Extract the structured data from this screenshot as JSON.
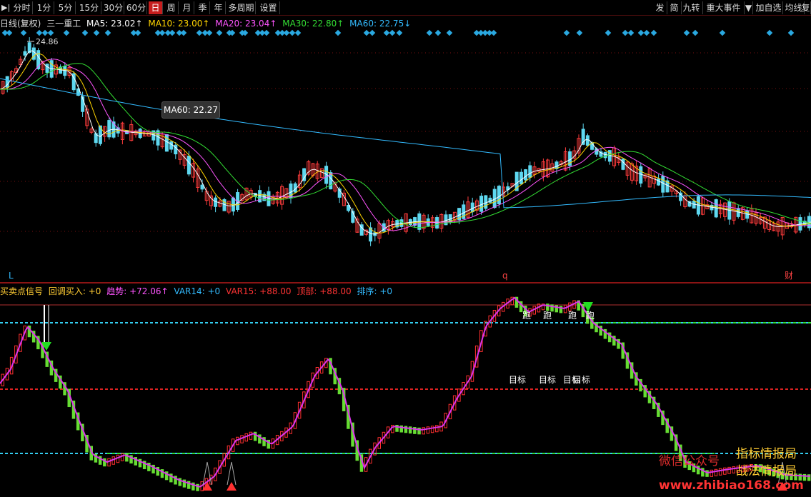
{
  "toolbar": {
    "items": [
      "分时",
      "1分",
      "5分",
      "15分",
      "30分",
      "60分",
      "日",
      "周",
      "月",
      "季",
      "年",
      "多周期",
      "设置"
    ],
    "active_index": 6,
    "right_items": [
      "发",
      "简",
      "九转",
      "重大事件",
      "加自选",
      "均线",
      "复"
    ]
  },
  "ma_legend": {
    "title": "日线(复权)",
    "stock": "三一重工",
    "ma5": "MA5: 23.02↑",
    "ma10": "MA10: 23.00↑",
    "ma20": "MA20: 23.04↑",
    "ma30": "MA30: 22.80↑",
    "ma60": "MA60: 22.75↓",
    "colors": {
      "ma5": "#ffffff",
      "ma10": "#ffd400",
      "ma20": "#ff55ff",
      "ma30": "#33dd33",
      "ma60": "#33bbff"
    }
  },
  "main_chart": {
    "high_label": "24.86",
    "tooltip": "MA60: 22.27",
    "bottom_markers": [
      "L",
      "q",
      "财"
    ]
  },
  "sub_legend": {
    "name": "买卖点信号",
    "pullback": "回调买入: +0",
    "trend": "趋势: +72.06↑",
    "var14": "VAR14: +0",
    "var15": "VAR15: +88.00",
    "top": "顶部: +88.00",
    "rank": "排序: +0"
  },
  "sub_chart": {
    "labels_run": [
      "跑",
      "跑",
      "跑",
      "跑"
    ],
    "labels_target": [
      "目标",
      "目标",
      "目标",
      "目标"
    ]
  },
  "watermark": {
    "wechat": "微信公众号",
    "line1": "指标情报局",
    "line2": "战法情报局",
    "site": "www.zhibiao168.com"
  }
}
